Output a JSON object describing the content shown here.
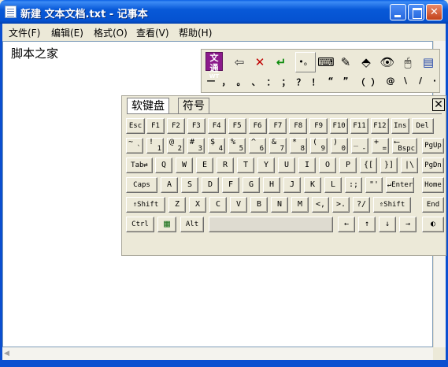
{
  "window": {
    "title": "新建 文本文档.txt - 记事本",
    "buttons": {
      "minimize": "",
      "maximize": "",
      "close": "✕"
    }
  },
  "menu": [
    {
      "label": "文件(F)"
    },
    {
      "label": "编辑(E)"
    },
    {
      "label": "格式(O)"
    },
    {
      "label": "查看(V)"
    },
    {
      "label": "帮助(H)"
    }
  ],
  "editor": {
    "content": "脚本之家"
  },
  "ime": {
    "logo": "文通",
    "logo_sub": "WT",
    "buttons": [
      "⇦",
      "✕",
      "↵",
      "•。",
      "⌨",
      "✎",
      "⬘",
      "👁",
      "🖱",
      "▤"
    ],
    "symbols": [
      "—",
      "，",
      "。",
      "、",
      "：",
      "；",
      "？",
      "！",
      "“",
      "”",
      "（",
      "）",
      "@",
      "\\",
      "/",
      "·"
    ]
  },
  "softkeyboard": {
    "tabs": [
      "软键盘",
      "符号"
    ],
    "close": "✕",
    "rows": {
      "r1": [
        "Esc",
        "F1",
        "F2",
        "F3",
        "F4",
        "F5",
        "F6",
        "F7",
        "F8",
        "F9",
        "F10",
        "F11",
        "F12",
        "Ins",
        "Del"
      ],
      "r2": [
        [
          "~",
          "`"
        ],
        [
          "!",
          "1"
        ],
        [
          "@",
          "2"
        ],
        [
          "#",
          "3"
        ],
        [
          "$",
          "4"
        ],
        [
          "%",
          "5"
        ],
        [
          "^",
          "6"
        ],
        [
          "&",
          "7"
        ],
        [
          "*",
          "8"
        ],
        [
          "(",
          "9"
        ],
        [
          ")",
          "0"
        ],
        [
          "_",
          "-"
        ],
        [
          "+",
          "="
        ],
        [
          "⟵",
          "Bspc"
        ],
        [
          "PgUp",
          ""
        ]
      ],
      "r3": [
        "Tab⇄",
        "Q",
        "W",
        "E",
        "R",
        "T",
        "Y",
        "U",
        "I",
        "O",
        "P",
        "{[",
        "}]",
        "|\\",
        "PgDn"
      ],
      "r4": [
        "Caps",
        "A",
        "S",
        "D",
        "F",
        "G",
        "H",
        "J",
        "K",
        "L",
        ":;",
        "\"'",
        "↵Enter",
        "Home"
      ],
      "r5": [
        "⇑Shift",
        "Z",
        "X",
        "C",
        "V",
        "B",
        "N",
        "M",
        "<,",
        ">.",
        "?/",
        "⇑Shift",
        "End"
      ],
      "r6": [
        "Ctrl",
        "▦",
        "Alt",
        "",
        "←",
        "↑",
        "↓",
        "→",
        "◐"
      ]
    }
  },
  "colors": {
    "titlebar": "#0552d0",
    "frame": "#0b4fd0",
    "menubar": "#ece9d8",
    "ime_logo": "#8c1a8c"
  }
}
